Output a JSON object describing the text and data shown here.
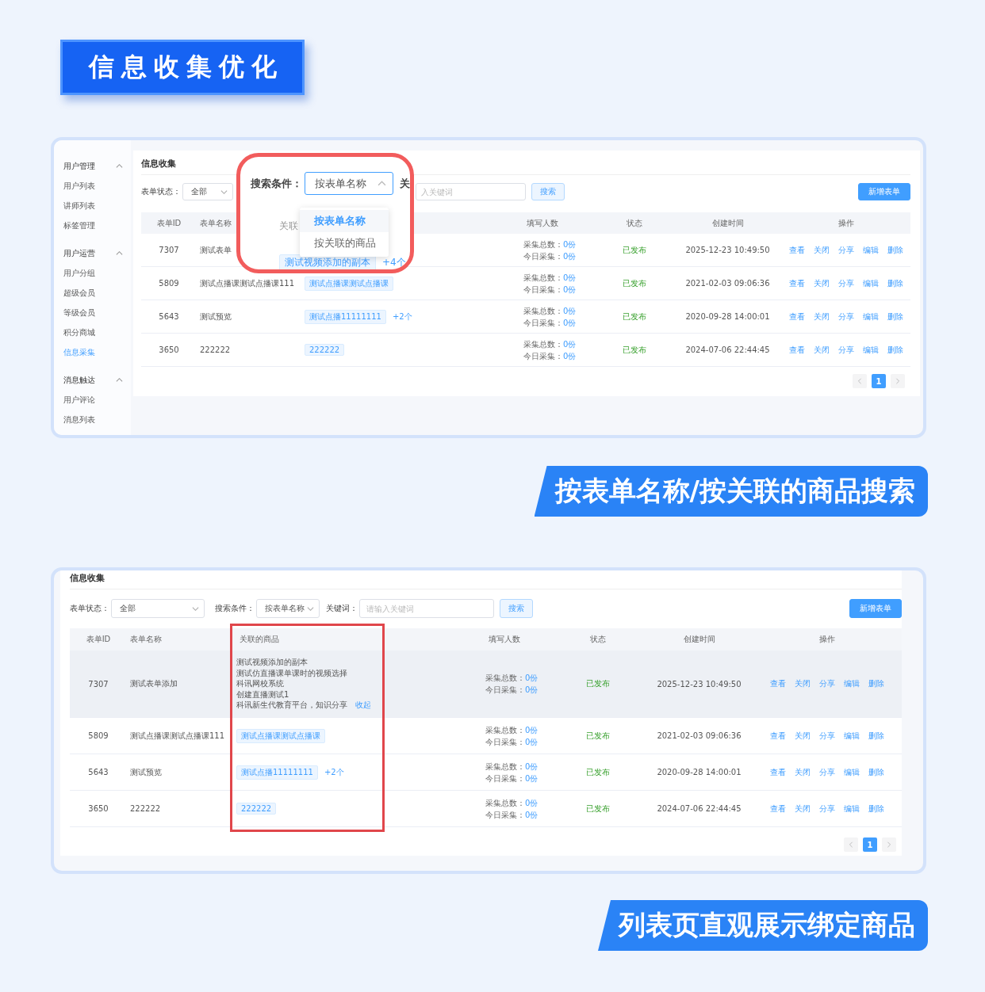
{
  "headline": "信息收集优化",
  "screen_1": {
    "sidebar": [
      {
        "title": "用户管理",
        "expanded": true,
        "items": [
          {
            "label": "用户列表",
            "selected": false
          },
          {
            "label": "讲师列表",
            "selected": false
          },
          {
            "label": "标签管理",
            "selected": false
          }
        ]
      },
      {
        "title": "用户运营",
        "expanded": true,
        "items": [
          {
            "label": "用户分组",
            "selected": false
          },
          {
            "label": "超级会员",
            "selected": false
          },
          {
            "label": "等级会员",
            "selected": false
          },
          {
            "label": "积分商城",
            "selected": false
          },
          {
            "label": "信息采集",
            "selected": true
          }
        ]
      },
      {
        "title": "消息触达",
        "expanded": true,
        "items": [
          {
            "label": "用户评论",
            "selected": false
          },
          {
            "label": "消息列表",
            "selected": false
          }
        ]
      }
    ],
    "title": "信息收集",
    "filters": [
      {
        "kind": "select",
        "label": "表单状态：",
        "value": "全部",
        "expanded": false
      },
      {
        "kind": "input",
        "placeholder": "入关键词"
      }
    ],
    "search_button": "搜索",
    "add_button": "新增表单",
    "columns": [
      "表单ID",
      "表单名称",
      "填写人数",
      "状态",
      "创建时间",
      "操作"
    ],
    "rows": [
      {
        "id": "7307",
        "name": "测试表单",
        "filled": [
          {
            "label": "采集总数：",
            "value": "0份"
          },
          {
            "label": "今日采集：",
            "value": "0份"
          }
        ],
        "status": "已发布",
        "created": "2025-12-23 10:49:50",
        "actions": [
          "查看",
          "关闭",
          "分享",
          "编辑",
          "删除"
        ],
        "hovered": false
      },
      {
        "id": "5809",
        "name": "测试点播课测试点播课111",
        "goods": {
          "kind": "tags",
          "tags": [
            "测试点播课测试点播课"
          ]
        },
        "filled": [
          {
            "label": "采集总数：",
            "value": "0份"
          },
          {
            "label": "今日采集：",
            "value": "0份"
          }
        ],
        "status": "已发布",
        "created": "2021-02-03 09:06:36",
        "actions": [
          "查看",
          "关闭",
          "分享",
          "编辑",
          "删除"
        ],
        "hovered": false
      },
      {
        "id": "5643",
        "name": "测试预览",
        "goods": {
          "kind": "tags",
          "tags": [
            "测试点播11111111"
          ],
          "more": "+2个"
        },
        "filled": [
          {
            "label": "采集总数：",
            "value": "0份"
          },
          {
            "label": "今日采集：",
            "value": "0份"
          }
        ],
        "status": "已发布",
        "created": "2020-09-28 14:00:01",
        "actions": [
          "查看",
          "关闭",
          "分享",
          "编辑",
          "删除"
        ],
        "hovered": false
      },
      {
        "id": "3650",
        "name": "222222",
        "goods": {
          "kind": "tags",
          "tags": [
            "222222"
          ]
        },
        "filled": [
          {
            "label": "采集总数：",
            "value": "0份"
          },
          {
            "label": "今日采集：",
            "value": "0份"
          }
        ],
        "status": "已发布",
        "created": "2024-07-06 22:44:45",
        "actions": [
          "查看",
          "关闭",
          "分享",
          "编辑",
          "删除"
        ],
        "hovered": false
      }
    ],
    "pagination": [
      {
        "label": "1",
        "selected": true
      }
    ],
    "zoom_popup": {
      "label": "搜索条件：",
      "value": "按表单名称",
      "expanded": true,
      "next_label": "关",
      "options": [
        {
          "label": "按表单名称",
          "selected": true
        },
        {
          "label": "按关联的商品",
          "selected": false
        }
      ],
      "column_header": "关联",
      "tag": "测试视频添加的副本",
      "more": "+4个"
    }
  },
  "caption_1": "按表单名称/按关联的商品搜索",
  "screen_2": {
    "title": "信息收集",
    "filters": [
      {
        "kind": "select",
        "label": "表单状态：",
        "value": "全部",
        "expanded": false
      },
      {
        "kind": "select",
        "label": "搜索条件：",
        "value": "按表单名称",
        "expanded": false
      },
      {
        "kind": "input",
        "label": "关键词：",
        "placeholder": "请输入关键词"
      }
    ],
    "search_button": "搜索",
    "add_button": "新增表单",
    "columns": [
      "表单ID",
      "表单名称",
      "填写人数",
      "状态",
      "创建时间",
      "操作"
    ],
    "goods_column": "关联的商品",
    "rows": [
      {
        "id": "7307",
        "name": "测试表单添加",
        "goods": {
          "kind": "list",
          "lines": [
            "测试视频添加的副本",
            "测试仿直播课单课时的视频选择",
            "科讯网校系统",
            "创建直播测试1",
            "科讯新生代教育平台，知识分享"
          ],
          "toggle": "收起"
        },
        "filled": [
          {
            "label": "采集总数：",
            "value": "0份"
          },
          {
            "label": "今日采集：",
            "value": "0份"
          }
        ],
        "status": "已发布",
        "created": "2025-12-23 10:49:50",
        "actions": [
          "查看",
          "关闭",
          "分享",
          "编辑",
          "删除"
        ],
        "hovered": true
      },
      {
        "id": "5809",
        "name": "测试点播课测试点播课111",
        "goods": {
          "kind": "tags",
          "tags": [
            "测试点播课测试点播课"
          ]
        },
        "filled": [
          {
            "label": "采集总数：",
            "value": "0份"
          },
          {
            "label": "今日采集：",
            "value": "0份"
          }
        ],
        "status": "已发布",
        "created": "2021-02-03 09:06:36",
        "actions": [
          "查看",
          "关闭",
          "分享",
          "编辑",
          "删除"
        ],
        "hovered": false
      },
      {
        "id": "5643",
        "name": "测试预览",
        "goods": {
          "kind": "tags",
          "tags": [
            "测试点播11111111"
          ],
          "more": "+2个"
        },
        "filled": [
          {
            "label": "采集总数：",
            "value": "0份"
          },
          {
            "label": "今日采集：",
            "value": "0份"
          }
        ],
        "status": "已发布",
        "created": "2020-09-28 14:00:01",
        "actions": [
          "查看",
          "关闭",
          "分享",
          "编辑",
          "删除"
        ],
        "hovered": false
      },
      {
        "id": "3650",
        "name": "222222",
        "goods": {
          "kind": "tags",
          "tags": [
            "222222"
          ]
        },
        "filled": [
          {
            "label": "采集总数：",
            "value": "0份"
          },
          {
            "label": "今日采集：",
            "value": "0份"
          }
        ],
        "status": "已发布",
        "created": "2024-07-06 22:44:45",
        "actions": [
          "查看",
          "关闭",
          "分享",
          "编辑",
          "删除"
        ],
        "hovered": false
      }
    ],
    "pagination": [
      {
        "label": "1",
        "selected": true
      }
    ],
    "goods_column_highlighted": true
  },
  "caption_2": "列表页直观展示绑定商品"
}
